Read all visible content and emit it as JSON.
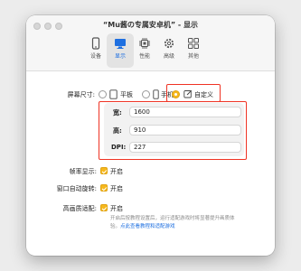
{
  "window": {
    "title": "“Mu酱の专属安卓机” - 显示"
  },
  "tabs": [
    {
      "label": "设备",
      "icon": "device-icon",
      "active": false
    },
    {
      "label": "显示",
      "icon": "display-icon",
      "active": true
    },
    {
      "label": "性能",
      "icon": "performance-icon",
      "active": false
    },
    {
      "label": "高级",
      "icon": "advanced-icon",
      "active": false
    },
    {
      "label": "其他",
      "icon": "other-icon",
      "active": false
    }
  ],
  "screen_size": {
    "label": "屏幕尺寸:",
    "options": [
      {
        "label": "平板",
        "icon": "tablet-icon",
        "selected": false
      },
      {
        "label": "手机",
        "icon": "phone-icon",
        "selected": false
      },
      {
        "label": "自定义",
        "icon": "edit-icon",
        "selected": true
      }
    ]
  },
  "custom_size": {
    "width_label": "宽:",
    "width_value": "1600",
    "height_label": "高:",
    "height_value": "910",
    "dpi_label": "DPI:",
    "dpi_value": "227"
  },
  "settings": {
    "frame_rate": {
      "label": "帧率显示:",
      "option": "开启",
      "checked": true
    },
    "auto_rotate": {
      "label": "窗口自动旋转:",
      "option": "开启",
      "checked": true
    },
    "hi_quality": {
      "label": "高画质适配:",
      "option": "开启",
      "checked": true,
      "note": "开启后按教程设置后，运行适配游戏时将显著提升画质体",
      "note_cont": "验。",
      "link": "点此查看教程和适配游戏"
    }
  },
  "colors": {
    "accent": "#f6b81d",
    "highlight": "#ef3324",
    "link": "#1e6fe0"
  }
}
